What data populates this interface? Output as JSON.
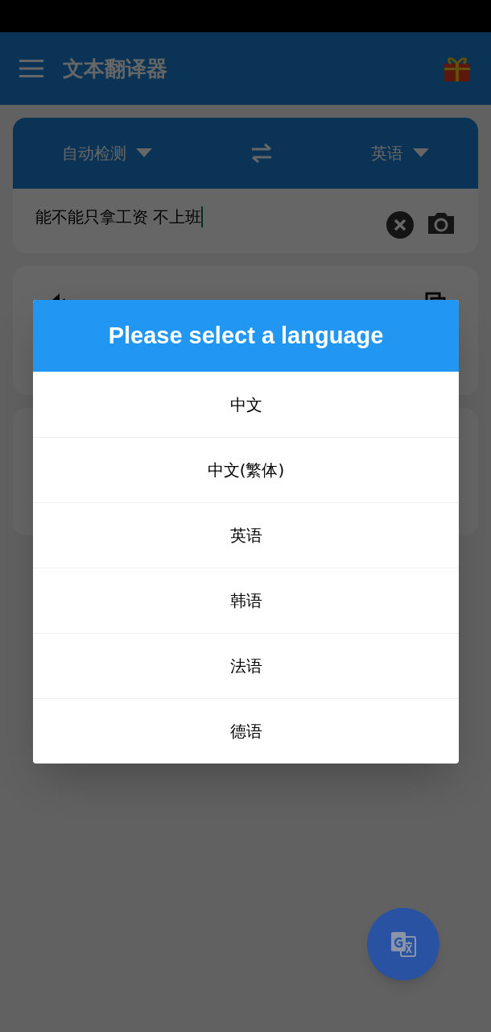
{
  "app_bar": {
    "title": "文本翻译器"
  },
  "language_bar": {
    "source": "自动检测",
    "target": "英语"
  },
  "input": {
    "value": "能不能只拿工资 不上班"
  },
  "dialog": {
    "title": "Please select a language",
    "options": [
      "中文",
      "中文(繁体)",
      "英语",
      "韩语",
      "法语",
      "德语"
    ]
  }
}
